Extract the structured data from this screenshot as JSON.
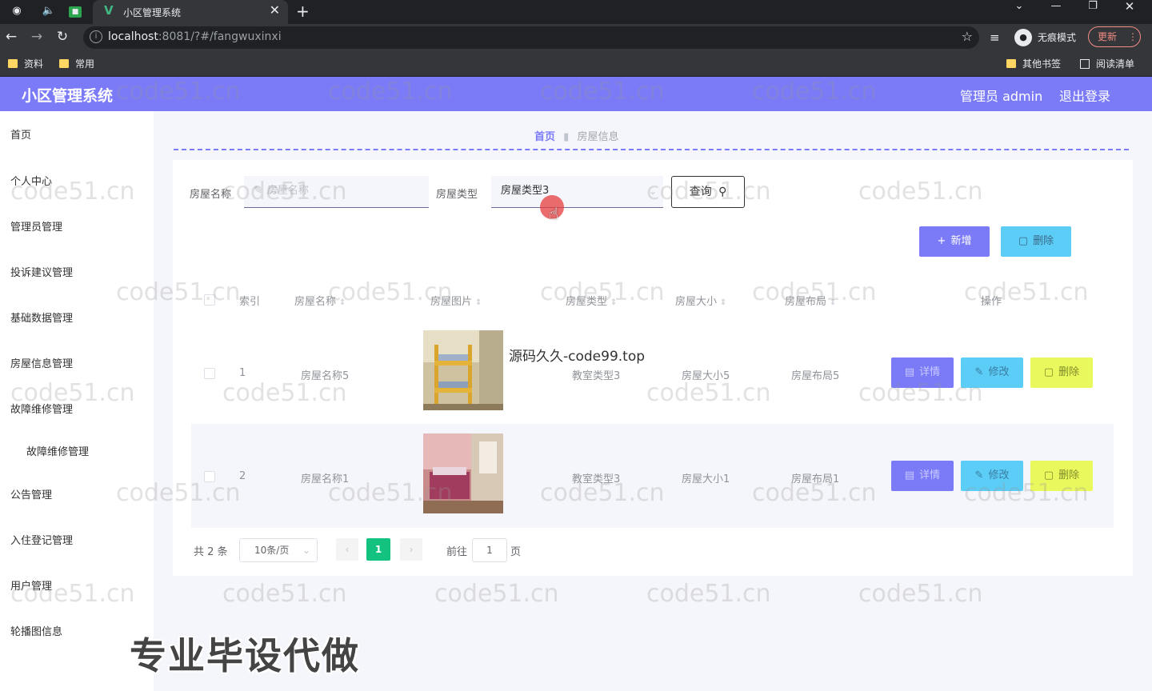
{
  "browser": {
    "tab_title": "小区管理系统",
    "url_host": "localhost",
    "url_rest": ":8081/?#/fangwuxinxi",
    "incognito_label": "无痕模式",
    "update_label": "更新",
    "bookmarks": [
      "资料",
      "常用"
    ],
    "bookmarks_right": [
      "其他书签",
      "阅读清单"
    ]
  },
  "header": {
    "title": "小区管理系统",
    "user": "管理员 admin",
    "logout": "退出登录",
    "accent_color": "#7b7bf8"
  },
  "sidebar": {
    "items": [
      "首页",
      "个人中心",
      "管理员管理",
      "投诉建议管理",
      "基础数据管理",
      "房屋信息管理",
      "故障维修管理",
      "故障维修管理",
      "公告管理",
      "入住登记管理",
      "用户管理",
      "轮播图信息"
    ]
  },
  "breadcrumb": {
    "home": "首页",
    "current": "房屋信息"
  },
  "search": {
    "name_label": "房屋名称",
    "name_placeholder": "房屋名称",
    "type_label": "房屋类型",
    "type_value": "房屋类型3",
    "query_label": "查询"
  },
  "actions": {
    "add_label": "新增",
    "delete_label": "删除"
  },
  "table": {
    "columns": [
      "索引",
      "房屋名称",
      "房屋图片",
      "房屋类型",
      "房屋大小",
      "房屋布局",
      "操作"
    ],
    "rows": [
      {
        "index": "1",
        "name": "房屋名称5",
        "type": "教室类型3",
        "size": "房屋大小5",
        "layout": "房屋布局5"
      },
      {
        "index": "2",
        "name": "房屋名称1",
        "type": "教室类型3",
        "size": "房屋大小1",
        "layout": "房屋布局1"
      }
    ],
    "op_detail": "详情",
    "op_edit": "修改",
    "op_delete": "删除"
  },
  "pagination": {
    "total": "共 2 条",
    "page_size": "10条/页",
    "current_page": "1",
    "goto_prefix": "前往",
    "goto_value": "1",
    "goto_suffix": "页"
  },
  "overlays": {
    "source_text": "源码久久-code99.top",
    "promo": "专业毕设代做",
    "watermark": "code51.cn"
  }
}
